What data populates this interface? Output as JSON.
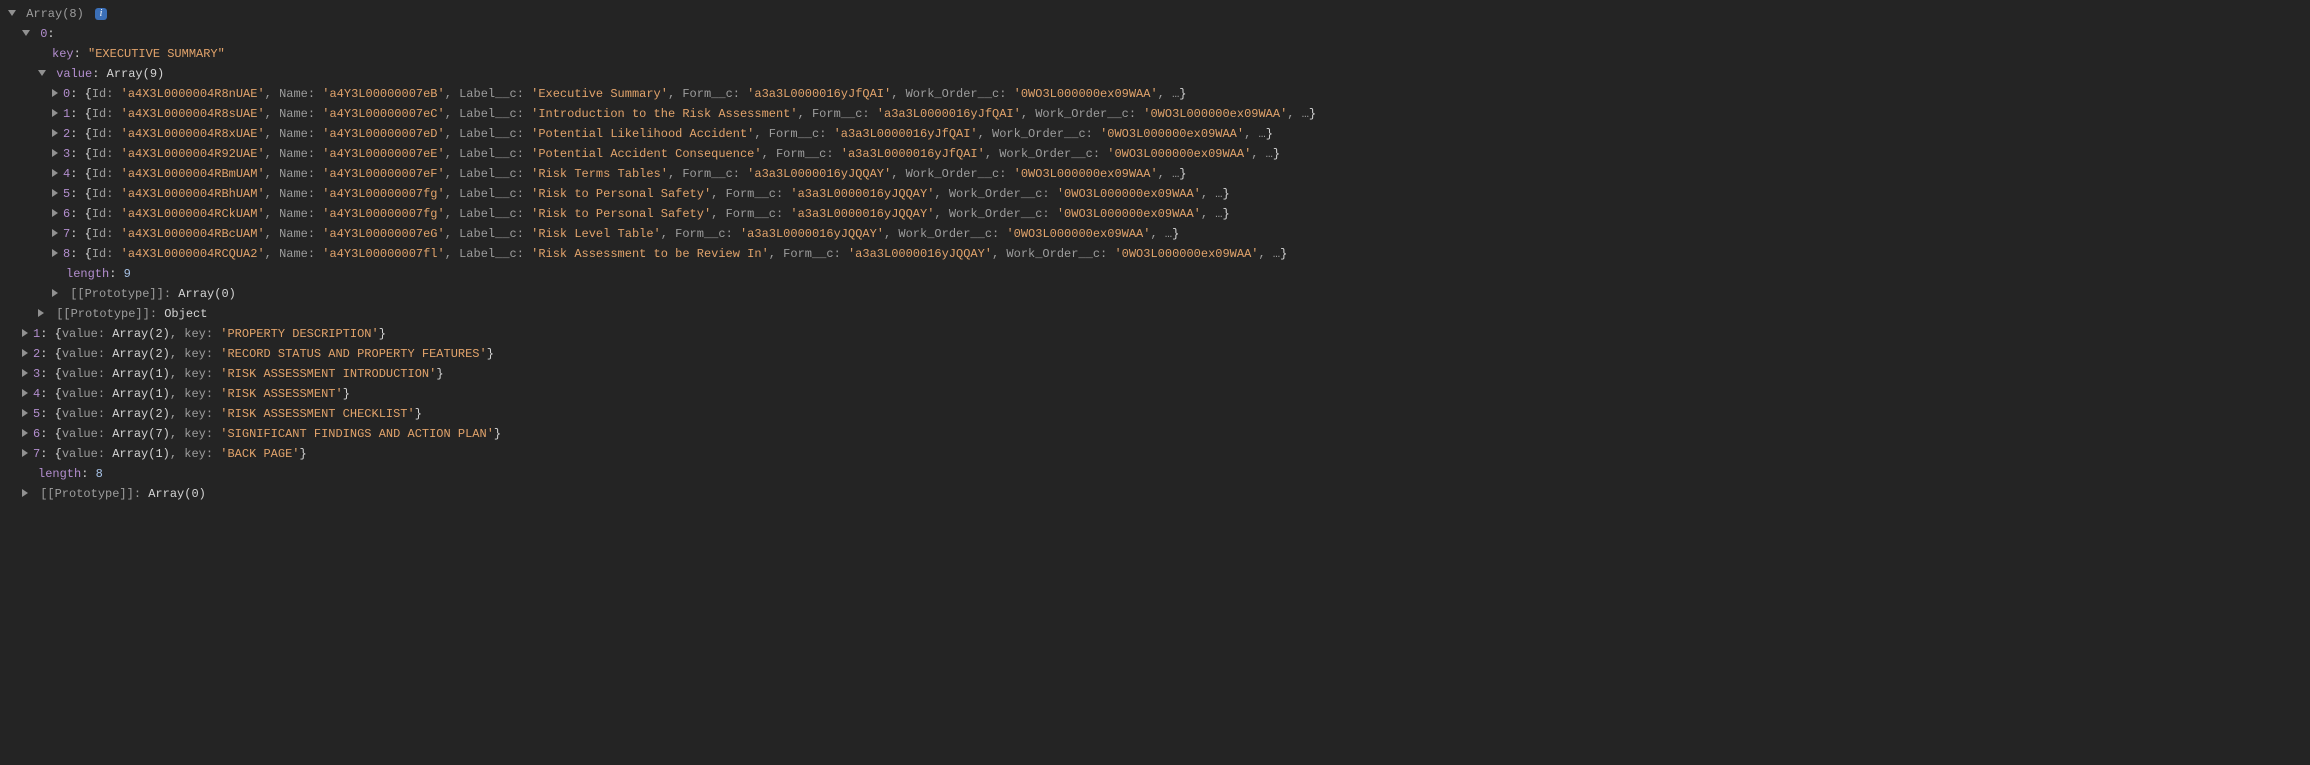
{
  "root": {
    "label_prefix": "Array(",
    "len": 8,
    "label_suffix": ")",
    "info": "i"
  },
  "idx0": {
    "idx": "0",
    "key_label": "key",
    "key_val": "\"EXECUTIVE SUMMARY\"",
    "value_label": "value",
    "value_type_prefix": "Array(",
    "value_len": 9,
    "value_type_suffix": ")",
    "rows": [
      {
        "i": "0",
        "Id": "'a4X3L0000004R8nUAE'",
        "Name": "'a4Y3L00000007eB'",
        "Label": "'Executive Summary'",
        "Form": "'a3a3L0000016yJfQAI'",
        "WO": "'0WO3L000000ex09WAA'"
      },
      {
        "i": "1",
        "Id": "'a4X3L0000004R8sUAE'",
        "Name": "'a4Y3L00000007eC'",
        "Label": "'Introduction to the Risk Assessment'",
        "Form": "'a3a3L0000016yJfQAI'",
        "WO": "'0WO3L000000ex09WAA'"
      },
      {
        "i": "2",
        "Id": "'a4X3L0000004R8xUAE'",
        "Name": "'a4Y3L00000007eD'",
        "Label": "'Potential Likelihood Accident'",
        "Form": "'a3a3L0000016yJfQAI'",
        "WO": "'0WO3L000000ex09WAA'"
      },
      {
        "i": "3",
        "Id": "'a4X3L0000004R92UAE'",
        "Name": "'a4Y3L00000007eE'",
        "Label": "'Potential Accident Consequence'",
        "Form": "'a3a3L0000016yJfQAI'",
        "WO": "'0WO3L000000ex09WAA'"
      },
      {
        "i": "4",
        "Id": "'a4X3L0000004RBmUAM'",
        "Name": "'a4Y3L00000007eF'",
        "Label": "'Risk Terms Tables'",
        "Form": "'a3a3L0000016yJQQAY'",
        "WO": "'0WO3L000000ex09WAA'"
      },
      {
        "i": "5",
        "Id": "'a4X3L0000004RBhUAM'",
        "Name": "'a4Y3L00000007fg'",
        "Label": "'Risk to Personal Safety'",
        "Form": "'a3a3L0000016yJQQAY'",
        "WO": "'0WO3L000000ex09WAA'"
      },
      {
        "i": "6",
        "Id": "'a4X3L0000004RCkUAM'",
        "Name": "'a4Y3L00000007fg'",
        "Label": "'Risk to Personal Safety'",
        "Form": "'a3a3L0000016yJQQAY'",
        "WO": "'0WO3L000000ex09WAA'"
      },
      {
        "i": "7",
        "Id": "'a4X3L0000004RBcUAM'",
        "Name": "'a4Y3L00000007eG'",
        "Label": "'Risk Level Table'",
        "Form": "'a3a3L0000016yJQQAY'",
        "WO": "'0WO3L000000ex09WAA'"
      },
      {
        "i": "8",
        "Id": "'a4X3L0000004RCQUA2'",
        "Name": "'a4Y3L00000007fl'",
        "Label": "'Risk Assessment to be Review In'",
        "Form": "'a3a3L0000016yJQQAY'",
        "WO": "'0WO3L000000ex09WAA'"
      }
    ],
    "length_label": "length",
    "length_val": 9,
    "proto_inner_label": "[[Prototype]]",
    "proto_inner_val": "Array(0)",
    "proto_outer_label": "[[Prototype]]",
    "proto_outer_val": "Object"
  },
  "labels": {
    "Id": "Id",
    "Name": "Name",
    "Label_c": "Label__c",
    "Form_c": "Form__c",
    "WO_c": "Work_Order__c",
    "value_word": "value",
    "key_word": "key",
    "Array_word": "Array"
  },
  "collapsed": [
    {
      "i": "1",
      "arrlen": "2",
      "key": "'PROPERTY DESCRIPTION'"
    },
    {
      "i": "2",
      "arrlen": "2",
      "key": "'RECORD STATUS AND PROPERTY FEATURES'"
    },
    {
      "i": "3",
      "arrlen": "1",
      "key": "'RISK ASSESSMENT INTRODUCTION'"
    },
    {
      "i": "4",
      "arrlen": "1",
      "key": "'RISK ASSESSMENT'"
    },
    {
      "i": "5",
      "arrlen": "2",
      "key": "'RISK ASSESSMENT CHECKLIST'"
    },
    {
      "i": "6",
      "arrlen": "7",
      "key": "'SIGNIFICANT FINDINGS AND ACTION PLAN'"
    },
    {
      "i": "7",
      "arrlen": "1",
      "key": "'BACK PAGE'"
    }
  ],
  "outer_length": {
    "label": "length",
    "val": 8
  },
  "outer_proto": {
    "label": "[[Prototype]]",
    "val": "Array(0)"
  }
}
